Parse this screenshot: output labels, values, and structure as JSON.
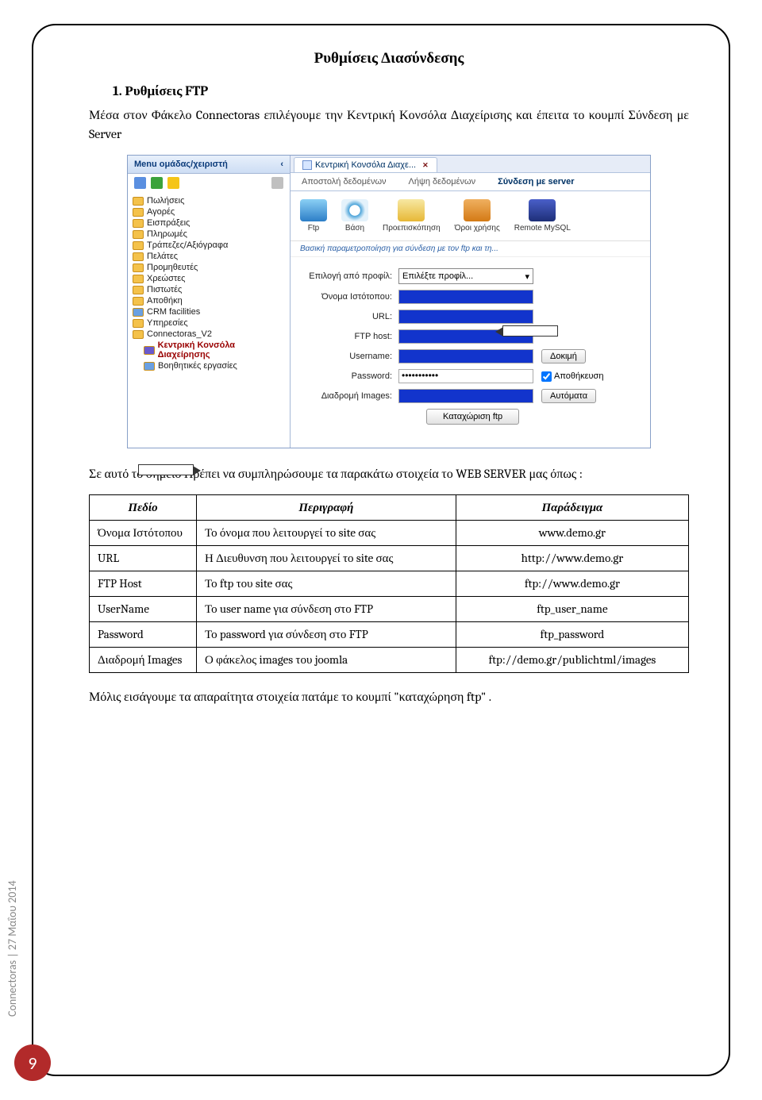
{
  "title": "Ρυθμίσεις Διασύνδεσης",
  "section": "1. Ρυθμίσεις FTP",
  "intro": "Μέσα στον Φάκελο Connectoras επιλέγουμε την Κεντρική Κονσόλα Διαχείρισης και έπειτα το κουμπί Σύνδεση με Server",
  "mid_text": "Σε αυτό το σημείο Πρέπει να συμπληρώσουμε τα παρακάτω στοιχεία το WEB SERVER μας όπως :",
  "closing": "Μόλις εισάγουμε τα απαραίτητα στοιχεία πατάμε το κουμπί \"καταχώρηση ftp\" .",
  "side_text": "Connectoras | 27 Μαΐου 2014",
  "page_number": "9",
  "screenshot": {
    "menu_title": "Menu ομάδας/χειριστή",
    "collapse_glyph": "‹",
    "tree": [
      "Πωλήσεις",
      "Αγορές",
      "Εισπράξεις",
      "Πληρωμές",
      "Τράπεζες/Αξιόγραφα",
      "Πελάτες",
      "Προμηθευτές",
      "Χρεώστες",
      "Πιστωτές",
      "Αποθήκη",
      "CRM facilities",
      "Υπηρεσίες",
      "Connectoras_V2"
    ],
    "tree_sub": [
      "Κεντρική Κονσόλα Διαχείρησης",
      "Βοηθητικές εργασίες"
    ],
    "doc_tab": "Κεντρική Κονσόλα Διαχε...",
    "doc_close": "✕",
    "sub_tabs": [
      "Αποστολή δεδομένων",
      "Λήψη δεδομένων",
      "Σύνδεση με server"
    ],
    "toolbar": [
      "Ftp",
      "Βάση",
      "Προεπισκόπηση",
      "Όροι χρήσης",
      "Remote MySQL"
    ],
    "crumb": "Βασική παραμετροποίηση για σύνδεση με τον ftp και τη...",
    "form": {
      "profile_label": "Επιλογή από προφίλ:",
      "profile_value": "Επιλέξτε προφίλ...",
      "site_label": "Όνομα Ιστότοπου:",
      "url_label": "URL:",
      "ftp_label": "FTP host:",
      "user_label": "Username:",
      "test_btn": "Δοκιμή",
      "pwd_label": "Password:",
      "pwd_value": "•••••••••••",
      "save_chk": "Αποθήκευση",
      "images_label": "Διαδρομή Images:",
      "auto_btn": "Αυτόματα",
      "register_btn": "Καταχώριση ftp"
    }
  },
  "table": {
    "h1": "Πεδίο",
    "h2": "Περιγραφή",
    "h3": "Παράδειγμα",
    "rows": [
      {
        "f": "Όνομα Ιστότοπου",
        "d": "Το όνομα που λειτουργεί το site σας",
        "e": "www.demo.gr"
      },
      {
        "f": "URL",
        "d": "Η Διευθυνση που λειτουργεί το site σας",
        "e": "http://www.demo.gr"
      },
      {
        "f": "FTP Host",
        "d": "Το ftp του site σας",
        "e": "ftp://www.demo.gr"
      },
      {
        "f": "UserName",
        "d": "Το user name για σύνδεση στο FTP",
        "e": "ftp_user_name"
      },
      {
        "f": "Password",
        "d": "Το password για σύνδεση στο FTP",
        "e": "ftp_password"
      },
      {
        "f": "Διαδρομή Images",
        "d": "Ο φάκελος images του joomla",
        "e": "ftp://demo.gr/publichtml/images"
      }
    ]
  }
}
